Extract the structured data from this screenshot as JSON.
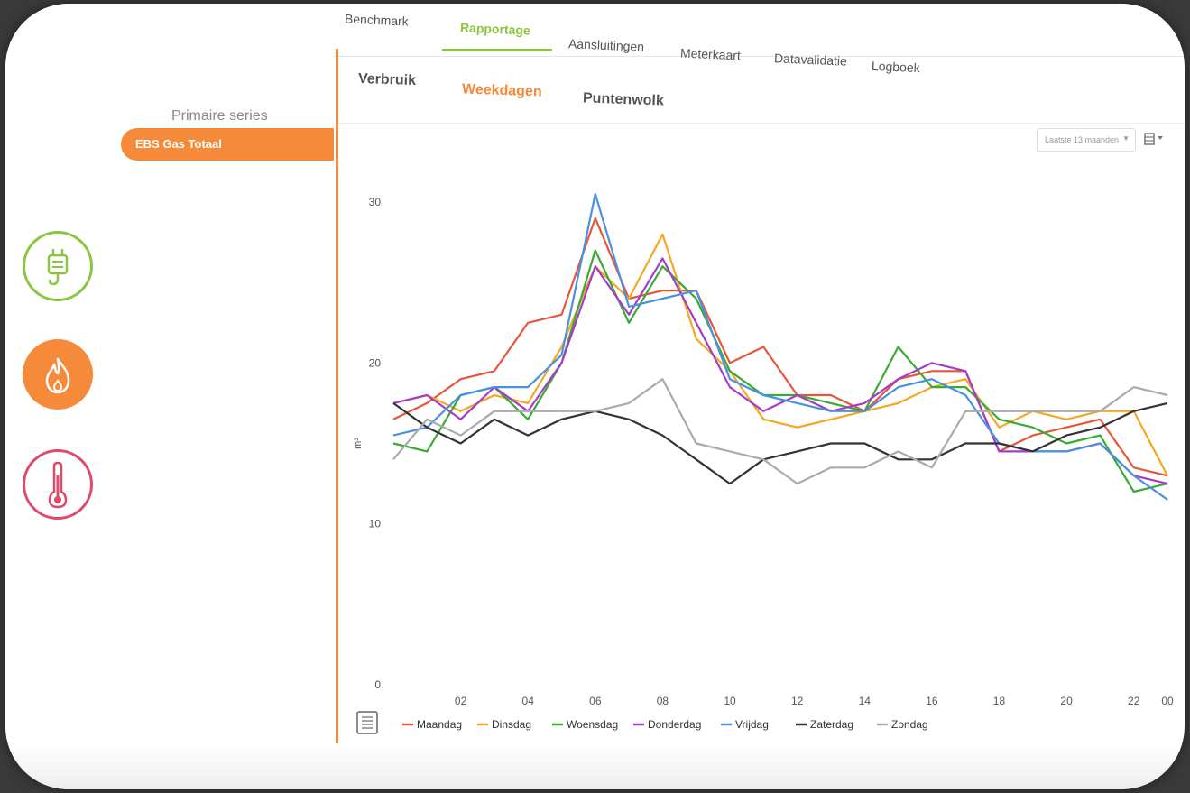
{
  "topnav": {
    "items": [
      {
        "label": "Benchmark",
        "active": false
      },
      {
        "label": "Rapportage",
        "active": true
      },
      {
        "label": "Aansluitingen",
        "active": false
      },
      {
        "label": "Meterkaart",
        "active": false
      },
      {
        "label": "Datavalidatie",
        "active": false
      },
      {
        "label": "Logboek",
        "active": false
      }
    ]
  },
  "sidebar": {
    "primary_title": "Primaire series",
    "selected_series": "EBS Gas Totaal",
    "categories": [
      {
        "icon": "plug-icon",
        "name": "electricity",
        "color": "#8cc63f",
        "active": false
      },
      {
        "icon": "flame-icon",
        "name": "gas",
        "color": "#f58a3a",
        "active": true
      },
      {
        "icon": "thermometer-icon",
        "name": "heat",
        "color": "#e04a6a",
        "active": false
      }
    ]
  },
  "subtabs": [
    {
      "label": "Verbruik",
      "active": false
    },
    {
      "label": "Weekdagen",
      "active": true
    },
    {
      "label": "Puntenwolk",
      "active": false
    }
  ],
  "toolbar": {
    "range_label": "Laatste 13 maanden",
    "menu_icon": "list-icon",
    "export_icon": "export-icon",
    "filter_icon": "funnel-icon"
  },
  "chart_data": {
    "type": "line",
    "ylabel": "m³",
    "ylim": [
      0,
      30
    ],
    "yticks": [
      0,
      10,
      20,
      30
    ],
    "x": [
      0,
      1,
      2,
      3,
      4,
      5,
      6,
      7,
      8,
      9,
      10,
      11,
      12,
      13,
      14,
      15,
      16,
      17,
      18,
      19,
      20,
      21,
      22,
      23
    ],
    "xticks": [
      {
        "x": 2,
        "label": "02"
      },
      {
        "x": 4,
        "label": "04"
      },
      {
        "x": 6,
        "label": "06"
      },
      {
        "x": 8,
        "label": "08"
      },
      {
        "x": 10,
        "label": "10"
      },
      {
        "x": 12,
        "label": "12"
      },
      {
        "x": 14,
        "label": "14"
      },
      {
        "x": 16,
        "label": "16"
      },
      {
        "x": 18,
        "label": "18"
      },
      {
        "x": 20,
        "label": "20"
      },
      {
        "x": 22,
        "label": "22"
      },
      {
        "x": 23,
        "label": "00"
      }
    ],
    "legend_position": "bottom",
    "series": [
      {
        "name": "Maandag",
        "color": "#e8563a",
        "values": [
          16.5,
          17.5,
          19,
          19.5,
          22.5,
          23,
          29,
          24,
          24.5,
          24.5,
          20,
          21,
          18,
          18,
          17,
          19,
          19.5,
          19.5,
          14.5,
          15.5,
          16,
          16.5,
          13.5,
          13
        ]
      },
      {
        "name": "Dinsdag",
        "color": "#f5a623",
        "values": [
          17.5,
          18,
          17,
          18,
          17.5,
          21,
          26,
          24,
          28,
          21.5,
          19.5,
          16.5,
          16,
          16.5,
          17,
          17.5,
          18.5,
          19,
          16,
          17,
          16.5,
          17,
          17,
          13
        ]
      },
      {
        "name": "Woensdag",
        "color": "#3aaa35",
        "values": [
          15,
          14.5,
          18,
          18.5,
          16.5,
          20,
          27,
          22.5,
          26,
          24,
          19.5,
          18,
          18,
          17.5,
          17,
          21,
          18.5,
          18.5,
          16.5,
          16,
          15,
          15.5,
          12,
          12.5
        ]
      },
      {
        "name": "Donderdag",
        "color": "#a53cc8",
        "values": [
          17.5,
          18,
          16.5,
          18.5,
          17,
          20,
          26,
          23,
          26.5,
          22.5,
          18.5,
          17,
          18,
          17,
          17.5,
          19,
          20,
          19.5,
          14.5,
          14.5,
          14.5,
          15,
          13,
          12.5
        ]
      },
      {
        "name": "Vrijdag",
        "color": "#4a90e2",
        "values": [
          15.5,
          16,
          18,
          18.5,
          18.5,
          20.5,
          30.5,
          23.5,
          24,
          24.5,
          19,
          18,
          17.5,
          17,
          17,
          18.5,
          19,
          18,
          15,
          14.5,
          14.5,
          15,
          13,
          11.5
        ]
      },
      {
        "name": "Zaterdag",
        "color": "#333333",
        "values": [
          17.5,
          16,
          15,
          16.5,
          15.5,
          16.5,
          17,
          16.5,
          15.5,
          14,
          12.5,
          14,
          14.5,
          15,
          15,
          14,
          14,
          15,
          15,
          14.5,
          15.5,
          16,
          17,
          17.5
        ]
      },
      {
        "name": "Zondag",
        "color": "#aaaaaa",
        "values": [
          14,
          16.5,
          15.5,
          17,
          17,
          17,
          17,
          17.5,
          19,
          15,
          14.5,
          14,
          12.5,
          13.5,
          13.5,
          14.5,
          13.5,
          17,
          17,
          17,
          17,
          17,
          18.5,
          18
        ]
      }
    ]
  }
}
